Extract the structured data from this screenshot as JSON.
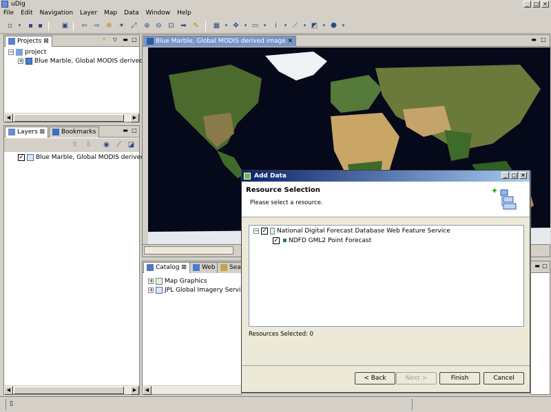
{
  "window": {
    "title": "uDig"
  },
  "menu": [
    "File",
    "Edit",
    "Navigation",
    "Layer",
    "Map",
    "Data",
    "Window",
    "Help"
  ],
  "projects_panel": {
    "tab_label": "Projects",
    "tree": {
      "root": "project",
      "child": "Blue Marble, Global MODIS derived ima"
    }
  },
  "layers_panel": {
    "tabs": [
      "Layers",
      "Bookmarks"
    ],
    "layer": "Blue Marble, Global MODIS derived imag"
  },
  "map_editor": {
    "tab_label": "Blue Marble, Global MODIS derived image"
  },
  "catalog_panel": {
    "tabs": [
      "Catalog",
      "Web",
      "Searc"
    ],
    "items": [
      "Map Graphics",
      "JPL Global Imagery Service"
    ]
  },
  "dialog": {
    "title": "Add Data",
    "heading": "Resource Selection",
    "subtitle": "Please select a resource.",
    "tree": {
      "service": "National Digital Forecast Database Web Feature Service",
      "resource": "NDFD GML2 Point Forecast"
    },
    "resources_selected": "Resources Selected: 0",
    "buttons": {
      "back": "< Back",
      "next": "Next >",
      "finish": "Finish",
      "cancel": "Cancel"
    }
  },
  "colors": {
    "title_gradient_start": "#0a246a",
    "title_gradient_end": "#a6caf0",
    "chrome": "#d4d0c8"
  }
}
